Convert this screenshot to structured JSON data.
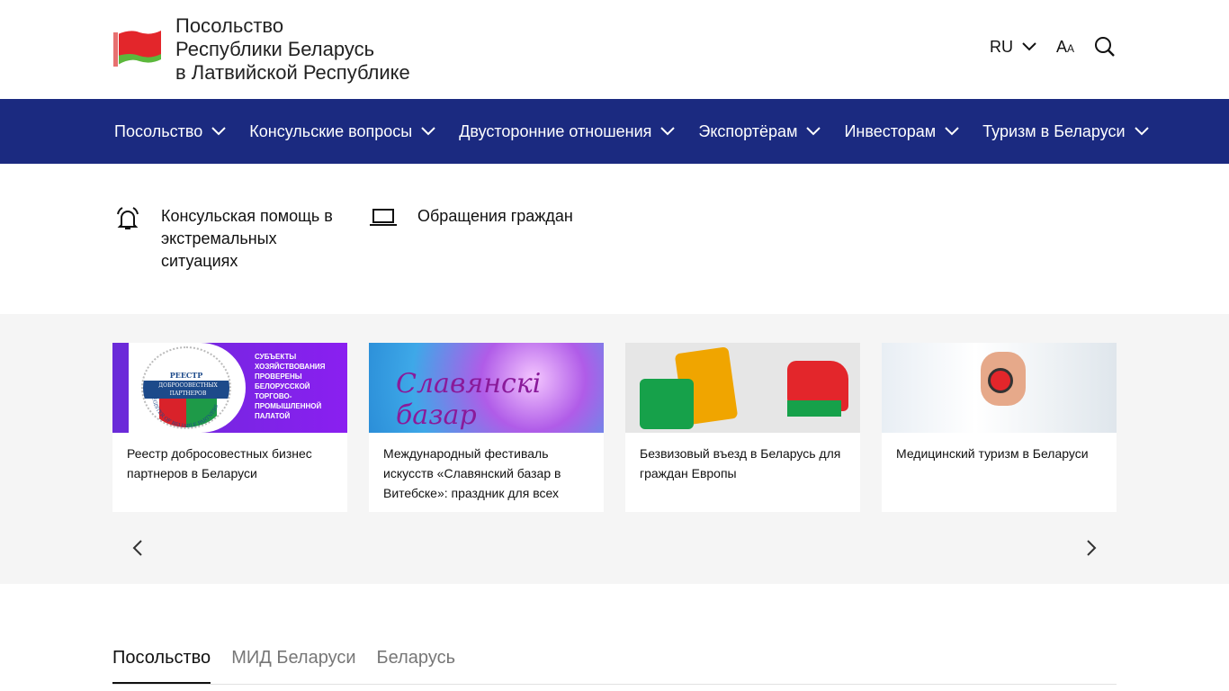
{
  "header": {
    "title_lines": [
      "Посольство",
      "Республики Беларусь",
      "в Латвийской Республике"
    ],
    "lang": "RU",
    "font_size_label": "A",
    "font_size_small": "A"
  },
  "nav": [
    {
      "label": "Посольство"
    },
    {
      "label": "Консульские вопросы"
    },
    {
      "label": "Двусторонние отношения"
    },
    {
      "label": "Экспортёрам"
    },
    {
      "label": "Инвесторам"
    },
    {
      "label": "Туризм в Беларуси"
    }
  ],
  "quick": [
    {
      "label": "Консульская помощь в экстремальных ситуациях",
      "icon": "bell-icon"
    },
    {
      "label": "Обращения граждан",
      "icon": "laptop-icon"
    }
  ],
  "cards": [
    {
      "title": "Реестр добросовестных бизнес партнеров в Беларуси",
      "img": {
        "top": "РЕЕСТР",
        "mid": "ДОБРОСОВЕСТНЫХ ПАРТНЕРОВ",
        "ring": "REGISTER OF RELIABLE PARTNERS",
        "side": "СУБЪЕКТЫ ХОЗЯЙСТВОВАНИЯ ПРОВЕРЕНЫ БЕЛОРУССКОЙ ТОРГОВО-ПРОМЫШЛЕННОЙ ПАЛАТОЙ"
      }
    },
    {
      "title": "Международный фестиваль искусств «Славянский базар в Витебске»: праздник для всех",
      "img": {
        "logo": "Славянскі базар"
      }
    },
    {
      "title": "Безвизовый въезд в Беларусь для граждан Европы"
    },
    {
      "title": "Медицинский туризм в Беларуси"
    }
  ],
  "tabs": [
    {
      "label": "Посольство",
      "active": true
    },
    {
      "label": "МИД Беларуси"
    },
    {
      "label": "Беларусь"
    }
  ],
  "colors": {
    "nav": "#1b2a80",
    "flag_red": "#e3262b",
    "flag_green": "#4caf3a"
  }
}
